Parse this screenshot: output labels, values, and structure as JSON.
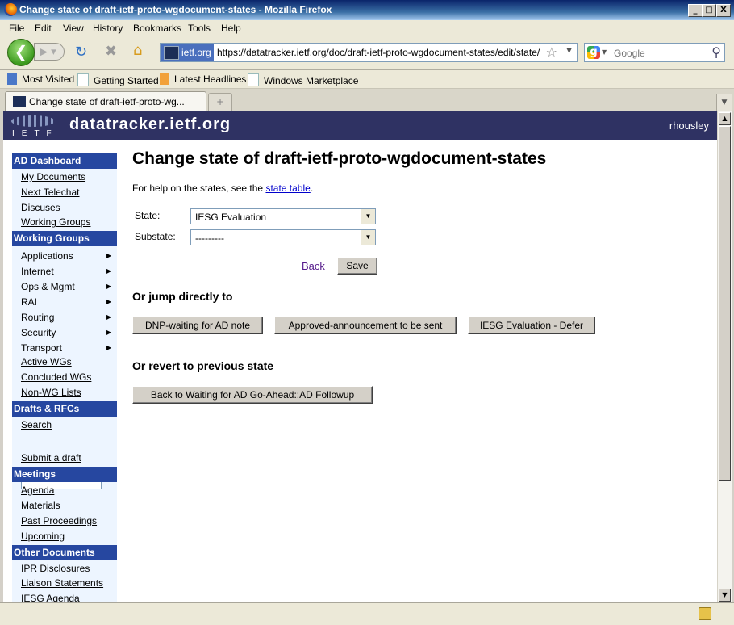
{
  "window": {
    "title": "Change state of draft-ietf-proto-wgdocument-states - Mozilla Firefox",
    "minimize": "_",
    "maximize": "□",
    "close": "X"
  },
  "menu": [
    "File",
    "Edit",
    "View",
    "History",
    "Bookmarks",
    "Tools",
    "Help"
  ],
  "nav": {
    "site_identity": "ietf.org",
    "url": "https://datatracker.ietf.org/doc/draft-ietf-proto-wgdocument-states/edit/state/",
    "search_placeholder": "Google"
  },
  "bookmarks": [
    "Most Visited",
    "Getting Started",
    "Latest Headlines",
    "Windows Marketplace"
  ],
  "tabs": [
    {
      "label": "Change state of draft-ietf-proto-wg..."
    }
  ],
  "banner": {
    "logo_text": "IETF",
    "site": "datatracker.ietf.org",
    "user": "rhousley"
  },
  "leftmenu": {
    "ad_dashboard": {
      "header": "AD Dashboard",
      "links": [
        "My Documents",
        "Next Telechat",
        "Discuses",
        "Working Groups"
      ]
    },
    "working_groups": {
      "header": "Working Groups",
      "areas": [
        "Applications",
        "Internet",
        "Ops & Mgmt",
        "RAI",
        "Routing",
        "Security",
        "Transport"
      ],
      "links": [
        "Active WGs",
        "Concluded WGs",
        "Non-WG Lists"
      ]
    },
    "drafts": {
      "header": "Drafts & RFCs",
      "search_link": "Search",
      "submit_link": "Submit a draft"
    },
    "meetings": {
      "header": "Meetings",
      "links": [
        "Agenda",
        "Materials",
        "Past Proceedings",
        "Upcoming"
      ]
    },
    "other": {
      "header": "Other Documents",
      "links": [
        "IPR Disclosures",
        "Liaison Statements",
        "IESG Agenda"
      ]
    }
  },
  "main": {
    "title": "Change state of draft-ietf-proto-wgdocument-states",
    "help_prefix": "For help on the states, see the ",
    "help_link": "state table",
    "help_suffix": ".",
    "state_label": "State:",
    "state_value": "IESG Evaluation",
    "substate_label": "Substate:",
    "substate_value": "---------",
    "back_label": "Back",
    "save_label": "Save",
    "jump_heading": "Or jump directly to",
    "jump_buttons": [
      "DNP-waiting for AD note",
      "Approved-announcement to be sent",
      "IESG Evaluation - Defer"
    ],
    "revert_heading": "Or revert to previous state",
    "revert_button": "Back to Waiting for AD Go-Ahead::AD Followup"
  }
}
